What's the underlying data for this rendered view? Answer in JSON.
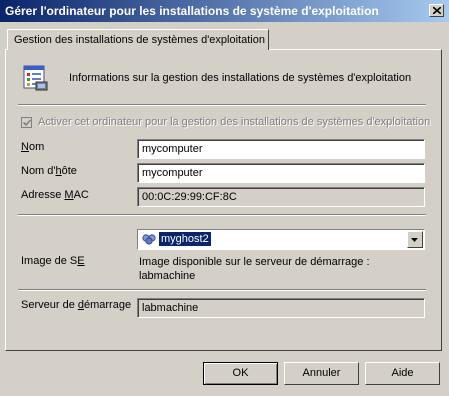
{
  "window": {
    "title": "Gérer l'ordinateur pour les installations de système d'exploitation",
    "close_icon": "close-icon"
  },
  "tab": {
    "label": "Gestion des installations de systèmes d'exploitation"
  },
  "info": {
    "icon": "os-install-info-icon",
    "text": "Informations sur la gestion des installations de systèmes d'exploitation"
  },
  "enable": {
    "checked": true,
    "disabled": true,
    "label": "Activer cet ordinateur pour la gestion des installations de systèmes d'exploitation"
  },
  "fields": {
    "name": {
      "label_pre": "",
      "label_u": "N",
      "label_post": "om",
      "value": "mycomputer"
    },
    "hostname": {
      "label_pre": "Nom d'",
      "label_u": "h",
      "label_post": "ôte",
      "value": "mycomputer"
    },
    "mac": {
      "label_pre": "Adresse ",
      "label_u": "M",
      "label_post": "AC",
      "value": "00:0C:29:99:CF:8C"
    }
  },
  "os_image": {
    "label_pre": "Image de S",
    "label_u": "E",
    "label_post": "",
    "selected": "myghost2",
    "icon": "ghost-image-icon",
    "availability_line1": "Image disponible sur le serveur de démarrage :",
    "availability_line2": "labmachine"
  },
  "boot_server": {
    "label_pre": "Serveur de ",
    "label_u": "d",
    "label_post": "émarrage",
    "value": "labmachine"
  },
  "buttons": {
    "ok": "OK",
    "cancel": "Annuler",
    "help": "Aide"
  }
}
